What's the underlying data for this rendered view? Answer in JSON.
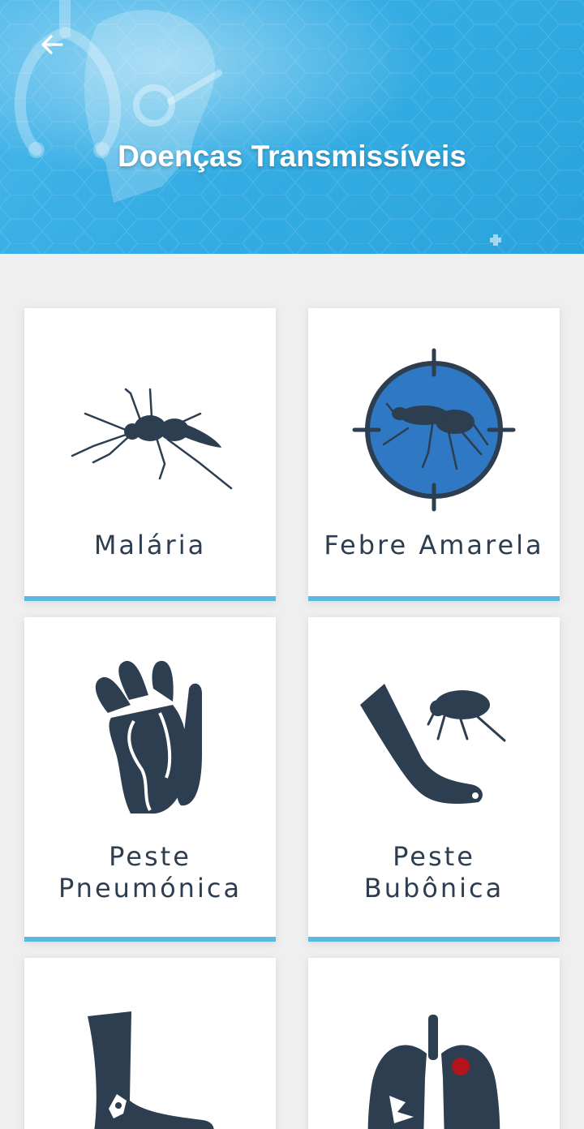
{
  "header": {
    "title": "Doenças Transmissíveis",
    "back_icon": "arrow-left-icon"
  },
  "colors": {
    "header_blue": "#35ade4",
    "card_bar": "#5bb8e0",
    "icon_dark": "#2c3e50",
    "target_blue": "#2f78c4",
    "lesion_red": "#b3141b"
  },
  "cards": [
    {
      "label": "Malária",
      "icon": "mosquito-icon"
    },
    {
      "label": "Febre Amarela",
      "icon": "mosquito-target-icon"
    },
    {
      "label": "Peste Pneumónica",
      "label_lines": [
        "Peste",
        "Pneumónica"
      ],
      "icon": "hands-icon"
    },
    {
      "label": "Peste Bubônica",
      "label_lines": [
        "Peste",
        "Bubônica"
      ],
      "icon": "flea-leg-icon"
    },
    {
      "label": "",
      "icon": "foot-icon"
    },
    {
      "label": "",
      "icon": "lungs-icon"
    }
  ]
}
